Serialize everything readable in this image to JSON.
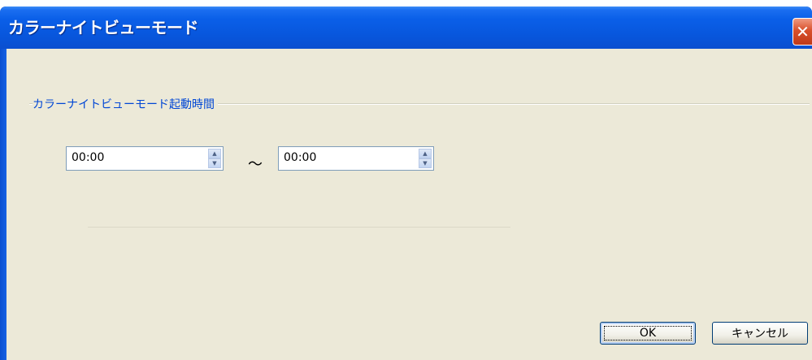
{
  "window": {
    "title": "カラーナイトビューモード",
    "close_icon": "close-icon",
    "close_color": "#d8502c"
  },
  "group": {
    "label": "カラーナイトビューモード起動時間"
  },
  "time_range": {
    "start_value": "00:00",
    "separator": "〜",
    "end_value": "00:00"
  },
  "buttons": {
    "ok_label": "OK",
    "cancel_label": "キャンセル"
  }
}
